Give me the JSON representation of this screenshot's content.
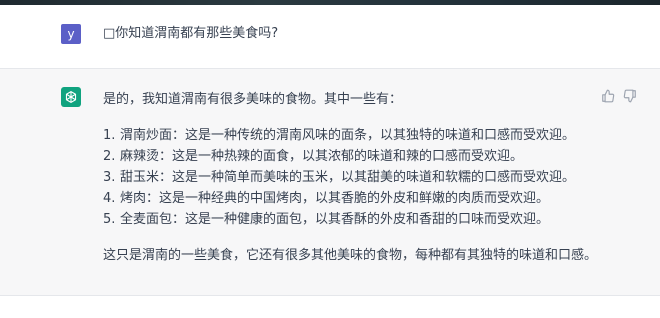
{
  "user": {
    "avatar_letter": "y",
    "message": "□你知道渭南都有那些美食吗?"
  },
  "assistant": {
    "intro": "是的，我知道渭南有很多美味的食物。其中一些有：",
    "items": [
      {
        "num": "1.",
        "text": "渭南炒面：这是一种传统的渭南风味的面条，以其独特的味道和口感而受欢迎。"
      },
      {
        "num": "2.",
        "text": "麻辣烫：这是一种热辣的面食，以其浓郁的味道和辣的口感而受欢迎。"
      },
      {
        "num": "3.",
        "text": "甜玉米：这是一种简单而美味的玉米，以其甜美的味道和软糯的口感而受欢迎。"
      },
      {
        "num": "4.",
        "text": "烤肉：这是一种经典的中国烤肉，以其香脆的外皮和鲜嫩的肉质而受欢迎。"
      },
      {
        "num": "5.",
        "text": "全麦面包：这是一种健康的面包，以其香酥的外皮和香甜的口味而受欢迎。"
      }
    ],
    "outro": "这只是渭南的一些美食，它还有很多其他美味的食物，每种都有其独特的味道和口感。"
  },
  "icons": {
    "assistant_avatar": "openai-logo-icon",
    "like": "thumbs-up-icon",
    "dislike": "thumbs-down-icon"
  },
  "colors": {
    "user_avatar_bg": "#5b5fc7",
    "assistant_avatar_bg": "#10a37f",
    "assistant_bg": "#f7f7f8"
  }
}
